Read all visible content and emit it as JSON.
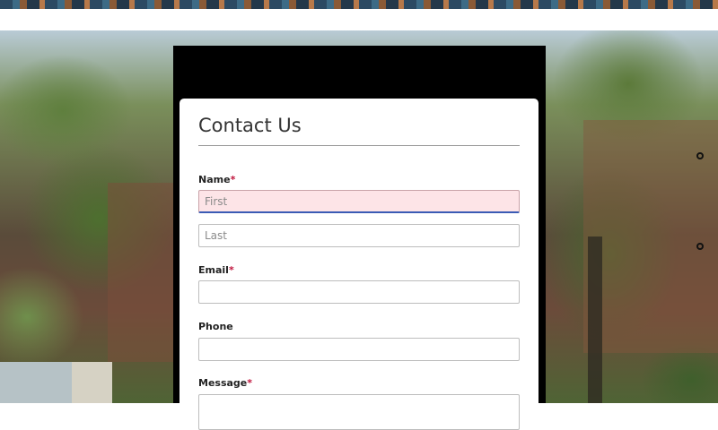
{
  "form": {
    "title": "Contact Us",
    "required_mark": "*",
    "name_label": "Name",
    "first_placeholder": "First",
    "last_placeholder": "Last",
    "email_label": "Email",
    "phone_label": "Phone",
    "message_label": "Message"
  },
  "colors": {
    "required": "#c0143c",
    "error_field_bg": "#fde4e7",
    "focus_underline": "#3b5bb5"
  }
}
